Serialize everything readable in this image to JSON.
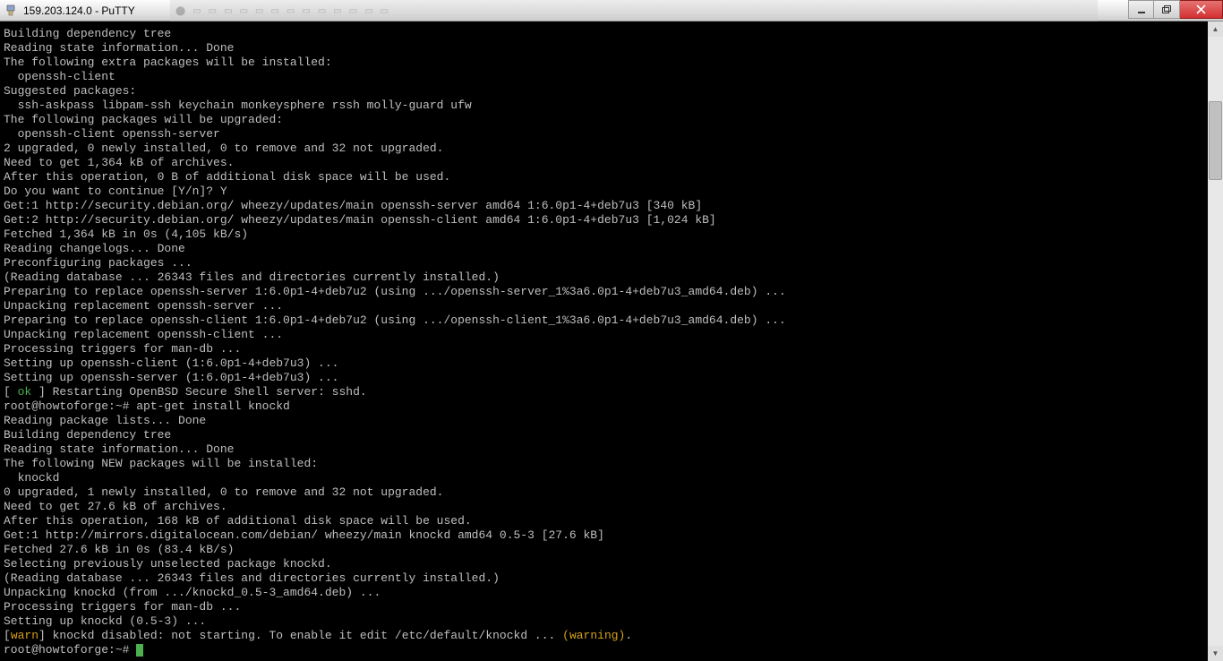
{
  "window": {
    "title": "159.203.124.0 - PuTTY"
  },
  "lines": [
    {
      "t": "Building dependency tree"
    },
    {
      "t": "Reading state information... Done"
    },
    {
      "t": "The following extra packages will be installed:"
    },
    {
      "t": "  openssh-client"
    },
    {
      "t": "Suggested packages:"
    },
    {
      "t": "  ssh-askpass libpam-ssh keychain monkeysphere rssh molly-guard ufw"
    },
    {
      "t": "The following packages will be upgraded:"
    },
    {
      "t": "  openssh-client openssh-server"
    },
    {
      "t": "2 upgraded, 0 newly installed, 0 to remove and 32 not upgraded."
    },
    {
      "t": "Need to get 1,364 kB of archives."
    },
    {
      "t": "After this operation, 0 B of additional disk space will be used."
    },
    {
      "t": "Do you want to continue [Y/n]? Y"
    },
    {
      "t": "Get:1 http://security.debian.org/ wheezy/updates/main openssh-server amd64 1:6.0p1-4+deb7u3 [340 kB]"
    },
    {
      "t": "Get:2 http://security.debian.org/ wheezy/updates/main openssh-client amd64 1:6.0p1-4+deb7u3 [1,024 kB]"
    },
    {
      "t": "Fetched 1,364 kB in 0s (4,105 kB/s)"
    },
    {
      "t": "Reading changelogs... Done"
    },
    {
      "t": "Preconfiguring packages ..."
    },
    {
      "t": "(Reading database ... 26343 files and directories currently installed.)"
    },
    {
      "t": "Preparing to replace openssh-server 1:6.0p1-4+deb7u2 (using .../openssh-server_1%3a6.0p1-4+deb7u3_amd64.deb) ..."
    },
    {
      "t": "Unpacking replacement openssh-server ..."
    },
    {
      "t": "Preparing to replace openssh-client 1:6.0p1-4+deb7u2 (using .../openssh-client_1%3a6.0p1-4+deb7u3_amd64.deb) ..."
    },
    {
      "t": "Unpacking replacement openssh-client ..."
    },
    {
      "t": "Processing triggers for man-db ..."
    },
    {
      "t": "Setting up openssh-client (1:6.0p1-4+deb7u3) ..."
    },
    {
      "t": "Setting up openssh-server (1:6.0p1-4+deb7u3) ..."
    },
    {
      "segments": [
        {
          "t": "[ "
        },
        {
          "t": "ok",
          "class": "ok"
        },
        {
          "t": " ] Restarting OpenBSD Secure Shell server: sshd."
        }
      ]
    },
    {
      "t": "root@howtoforge:~# apt-get install knockd"
    },
    {
      "t": "Reading package lists... Done"
    },
    {
      "t": "Building dependency tree"
    },
    {
      "t": "Reading state information... Done"
    },
    {
      "t": "The following NEW packages will be installed:"
    },
    {
      "t": "  knockd"
    },
    {
      "t": "0 upgraded, 1 newly installed, 0 to remove and 32 not upgraded."
    },
    {
      "t": "Need to get 27.6 kB of archives."
    },
    {
      "t": "After this operation, 168 kB of additional disk space will be used."
    },
    {
      "t": "Get:1 http://mirrors.digitalocean.com/debian/ wheezy/main knockd amd64 0.5-3 [27.6 kB]"
    },
    {
      "t": "Fetched 27.6 kB in 0s (83.4 kB/s)"
    },
    {
      "t": "Selecting previously unselected package knockd."
    },
    {
      "t": "(Reading database ... 26343 files and directories currently installed.)"
    },
    {
      "t": "Unpacking knockd (from .../knockd_0.5-3_amd64.deb) ..."
    },
    {
      "t": "Processing triggers for man-db ..."
    },
    {
      "t": "Setting up knockd (0.5-3) ..."
    },
    {
      "segments": [
        {
          "t": "["
        },
        {
          "t": "warn",
          "class": "warn"
        },
        {
          "t": "] knockd disabled: not starting. To enable it edit /etc/default/knockd ... "
        },
        {
          "t": "(warning)",
          "class": "warn"
        },
        {
          "t": "."
        }
      ]
    },
    {
      "t": "root@howtoforge:~# ",
      "cursor": true
    }
  ],
  "scrollbar": {
    "thumbTop": 72,
    "thumbHeight": 88
  }
}
